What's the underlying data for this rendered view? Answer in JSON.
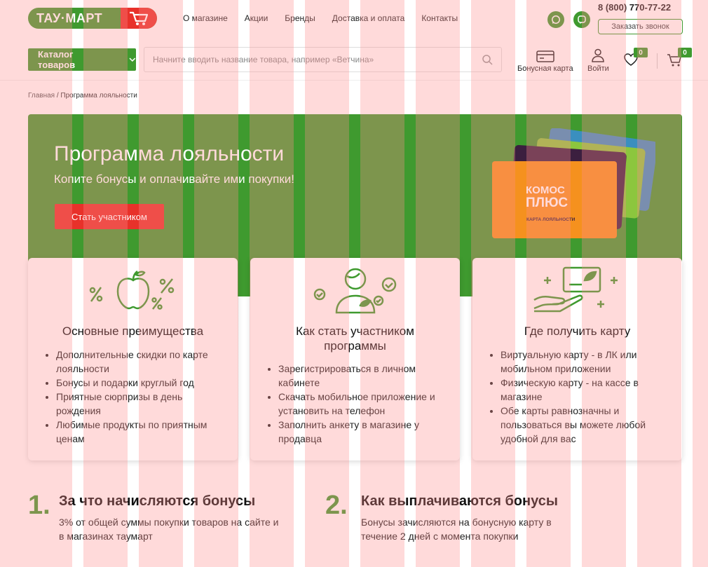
{
  "header": {
    "logo_text": "ТАУ·МАРТ",
    "nav": [
      "О магазине",
      "Акции",
      "Бренды",
      "Доставка и оплата",
      "Контакты"
    ],
    "phone": "8 (800) 770-77-22",
    "callback_label": "Заказать звонок",
    "messengers": [
      "whatsapp-icon",
      "viber-icon"
    ]
  },
  "toolbar": {
    "catalog_label": "Каталог товаров",
    "search_placeholder": "Начните вводить название товара, например «Ветчина»",
    "bonus_card_label": "Бонусная карта",
    "login_label": "Войти",
    "wishlist_count": "0",
    "cart_count": "0"
  },
  "breadcrumbs": {
    "home": "Главная",
    "separator": "/",
    "current": "Программа лояльности"
  },
  "hero": {
    "title": "Программа лояльности",
    "subtitle": "Копите бонусы и оплачивайте ими покупки!",
    "cta": "Стать участником",
    "card_brand_line1": "КОМОС",
    "card_brand_line2": "ПЛЮС",
    "card_caption": "КАРТА ЛОЯЛЬНОСТИ"
  },
  "info_cards": [
    {
      "icon": "apple-percent-icon",
      "title": "Основные преимущества",
      "items": [
        "Дополнительные скидки по карте лояльности",
        "Бонусы и подарки круглый год",
        "Приятные сюрпризы в день рождения",
        "Любимые продукты по приятным ценам"
      ]
    },
    {
      "icon": "member-icon",
      "title": "Как стать участником программы",
      "items": [
        "Зарегистрироваться в личном кабинете",
        "Скачать мобильное приложение и установить на телефон",
        "Заполнить анкету в магазине у продавца"
      ]
    },
    {
      "icon": "card-hand-icon",
      "title": "Где получить карту",
      "items": [
        "Виртуальную карту - в ЛК или мобильном приложении",
        "Физическую карту - на кассе в магазине",
        "Обе карты равнозначны и пользоваться вы можете любой удобной для вас"
      ]
    }
  ],
  "steps": [
    {
      "num": "1.",
      "title": "За что начисляются бонусы",
      "text": "3% от общей суммы покупки товаров на сайте и в магазинах таумарт"
    },
    {
      "num": "2.",
      "title": "Как выплачиваются бонусы",
      "text": "Бонусы зачисляются на бонусную карту в течение 2 дней с момента покупки"
    }
  ],
  "colors": {
    "brand_green": "#3f9a2f",
    "accent_red": "#e8312a",
    "card_orange": "#f5911e"
  }
}
